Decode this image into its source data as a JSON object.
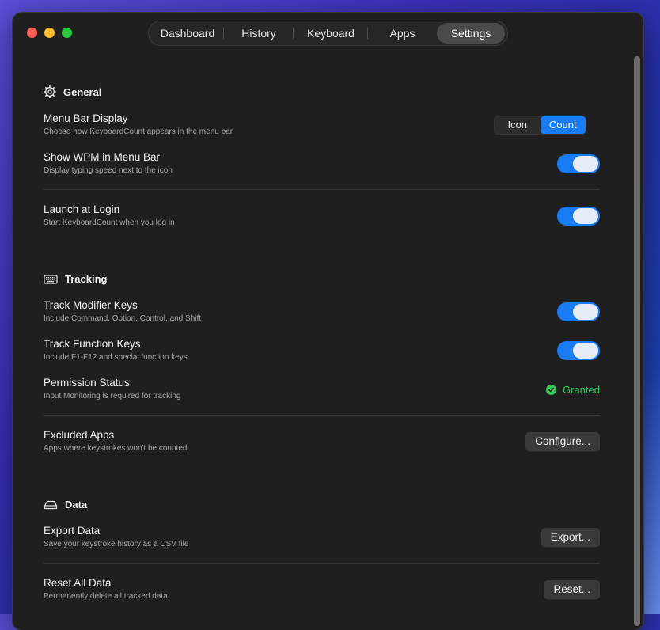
{
  "tabs": [
    "Dashboard",
    "History",
    "Keyboard",
    "Apps",
    "Settings"
  ],
  "active_tab": "Settings",
  "general": {
    "title": "General",
    "icon": "gear-icon",
    "menu_bar_display": {
      "title": "Menu Bar Display",
      "subtitle": "Choose how KeyboardCount appears in the menu bar",
      "options": [
        "Icon",
        "Count"
      ],
      "selected": "Count"
    },
    "show_wpm": {
      "title": "Show WPM in Menu Bar",
      "subtitle": "Display typing speed next to the icon",
      "on": true
    },
    "launch_at_login": {
      "title": "Launch at Login",
      "subtitle": "Start KeyboardCount when you log in",
      "on": true
    }
  },
  "tracking": {
    "title": "Tracking",
    "icon": "keyboard-icon",
    "modifier_keys": {
      "title": "Track Modifier Keys",
      "subtitle": "Include Command, Option, Control, and Shift",
      "on": true
    },
    "function_keys": {
      "title": "Track Function Keys",
      "subtitle": "Include F1-F12 and special function keys",
      "on": true
    },
    "permission": {
      "title": "Permission Status",
      "subtitle": "Input Monitoring is required for tracking",
      "status": "Granted"
    },
    "excluded_apps": {
      "title": "Excluded Apps",
      "subtitle": "Apps where keystrokes won't be counted",
      "button": "Configure..."
    }
  },
  "data": {
    "title": "Data",
    "icon": "drive-icon",
    "export": {
      "title": "Export Data",
      "subtitle": "Save your keystroke history as a CSV file",
      "button": "Export..."
    },
    "reset": {
      "title": "Reset All Data",
      "subtitle": "Permanently delete all tracked data",
      "button": "Reset..."
    }
  },
  "colors": {
    "accent": "#1a7cf5",
    "granted": "#35c759"
  }
}
